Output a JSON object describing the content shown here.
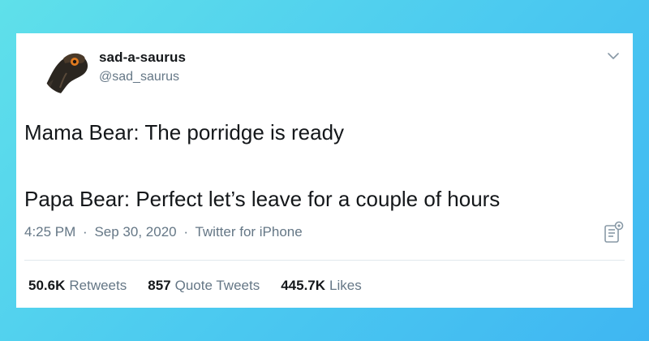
{
  "user": {
    "display_name": "sad-a-saurus",
    "handle": "@sad_saurus"
  },
  "tweet": {
    "line1": "Mama Bear: The porridge is ready",
    "line2": "Papa Bear: Perfect let’s leave for a couple of hours"
  },
  "meta": {
    "time": "4:25 PM",
    "separator": "·",
    "date": "Sep 30, 2020",
    "source": "Twitter for iPhone"
  },
  "stats": {
    "retweets_count": "50.6K",
    "retweets_label": "Retweets",
    "quotes_count": "857",
    "quotes_label": "Quote Tweets",
    "likes_count": "445.7K",
    "likes_label": "Likes"
  },
  "icons": {
    "chevron": "chevron-down-icon",
    "analytics": "analytics-icon",
    "avatar": "avatar-bird-image"
  },
  "colors": {
    "background_start": "#5fe0ea",
    "background_end": "#3fb6f2",
    "card": "#ffffff",
    "text_primary": "#14171a",
    "text_secondary": "#657786",
    "divider": "#e1e8ed"
  }
}
